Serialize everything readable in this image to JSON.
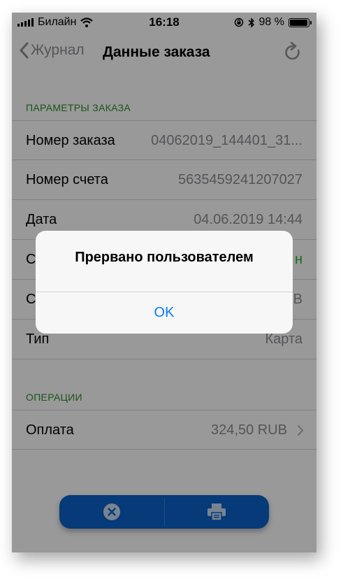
{
  "status_bar": {
    "carrier": "Билайн",
    "time": "16:18",
    "battery": "98 %"
  },
  "nav": {
    "back_label": "Журнал",
    "title": "Данные заказа"
  },
  "sections": {
    "params_header": "ПАРАМЕТРЫ ЗАКАЗА",
    "operations_header": "ОПЕРАЦИИ"
  },
  "rows": [
    {
      "label": "Номер заказа",
      "value": "04062019_144401_31..."
    },
    {
      "label": "Номер счета",
      "value": "5635459241207027"
    },
    {
      "label": "Дата",
      "value": "04.06.2019 14:44"
    },
    {
      "label": "С",
      "value": "н"
    },
    {
      "label": "С",
      "value": "В"
    },
    {
      "label": "Тип",
      "value": "Карта"
    }
  ],
  "operation": {
    "label": "Оплата",
    "value": "324,50 RUB"
  },
  "alert": {
    "message": "Прервано пользователем",
    "ok_label": "OK"
  },
  "colors": {
    "accent": "#0a7aff",
    "section_green": "#2e8b2e",
    "bottom_bar": "#0a62c9"
  }
}
